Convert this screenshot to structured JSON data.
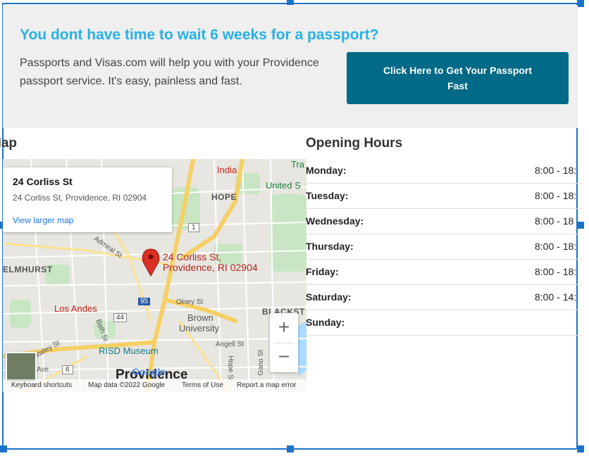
{
  "banner": {
    "title": "You dont have time to wait 6 weeks for a passport?",
    "text": "Passports and Visas.com will help you with your Providence passport service. It's easy, painless and fast.",
    "cta_label": "Click Here to Get Your Passport Fast"
  },
  "map_section": {
    "heading": "Map",
    "card": {
      "title": "24 Corliss St",
      "address": "24 Corliss St, Providence, RI 02904",
      "link": "View larger map"
    },
    "pin_label_line1": "24 Corliss St,",
    "pin_label_line2": "Providence, RI 02904",
    "labels": {
      "hope": "HOPE",
      "elmhurst": "ELMHURST",
      "india": "India",
      "trader": "Tra",
      "united": "United S",
      "los_andes": "Los Andes",
      "brown_line1": "Brown",
      "brown_line2": "University",
      "risd": "RISD Museum",
      "blackst": "BLACKST",
      "olney": "Olney St",
      "angell": "Angell St",
      "admiral": "Admiral St",
      "valley": "Valley St",
      "bath": "Bath St",
      "hope_st": "Hope St",
      "gano": "Gano St",
      "ave": "Ave",
      "city": "Providence"
    },
    "shields": {
      "r1": "1",
      "i95": "95",
      "us44": "44",
      "r6": "6"
    },
    "google_logo": "Google",
    "attribution": {
      "shortcuts": "Keyboard shortcuts",
      "data": "Map data ©2022 Google",
      "terms": "Terms of Use",
      "report": "Report a map error"
    },
    "zoom_in": "+",
    "zoom_out": "−"
  },
  "hours_section": {
    "heading": "Opening Hours",
    "rows": [
      {
        "day": "Monday:",
        "time": "8:00 - 18:"
      },
      {
        "day": "Tuesday:",
        "time": "8:00 - 18:"
      },
      {
        "day": "Wednesday:",
        "time": "8:00 - 18"
      },
      {
        "day": "Thursday:",
        "time": "8:00 - 18:"
      },
      {
        "day": "Friday:",
        "time": "8:00 - 18:"
      },
      {
        "day": "Saturday:",
        "time": "8:00 - 14:"
      },
      {
        "day": "Sunday:",
        "time": ""
      }
    ]
  },
  "colors": {
    "title": "#27b1e6",
    "cta_bg": "#006a87",
    "selection": "#1a73c8",
    "pin": "#d93025",
    "link": "#1a73e8"
  }
}
